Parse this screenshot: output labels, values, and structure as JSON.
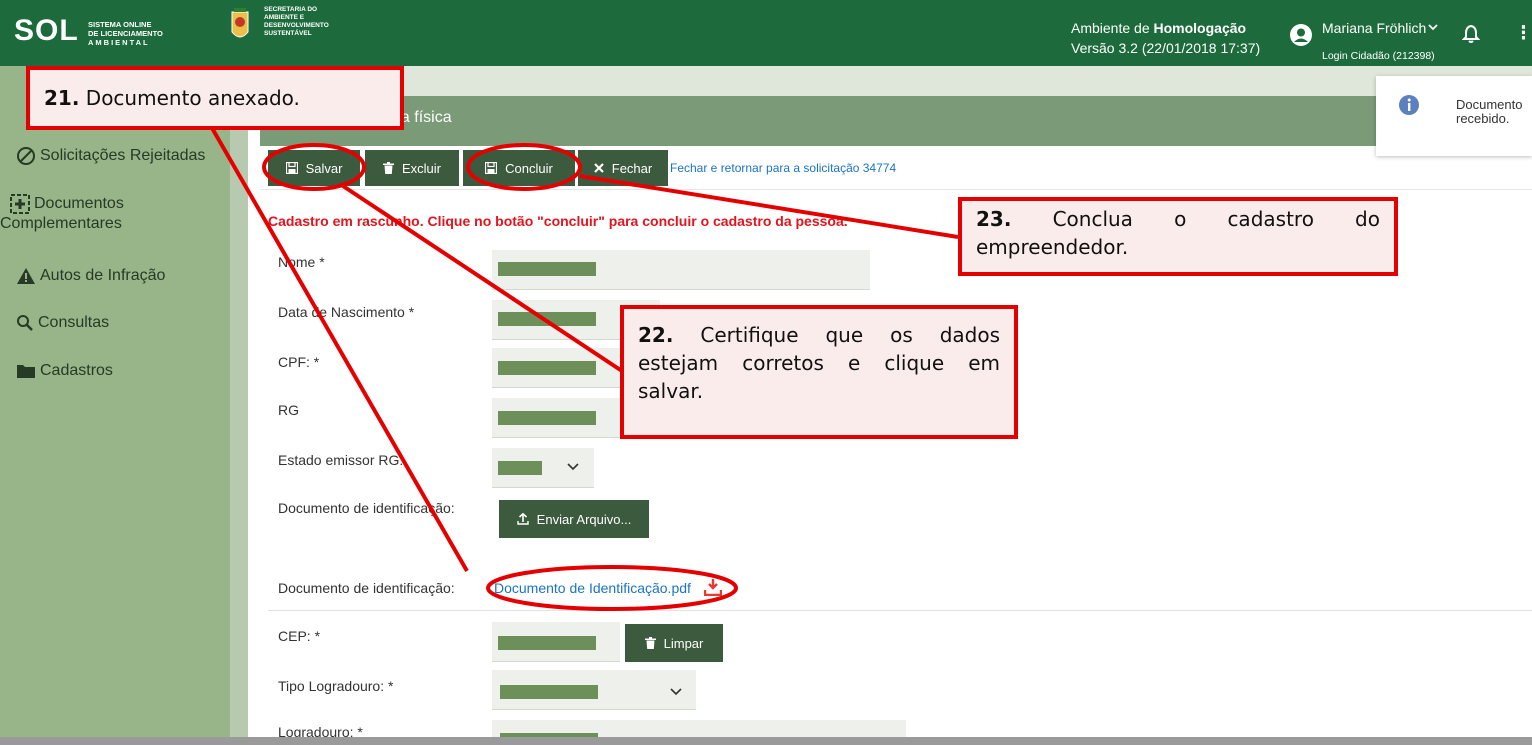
{
  "header": {
    "logo_word": "SOL",
    "logo_sub_line1": "SISTEMA ONLINE",
    "logo_sub_line2": "DE LICENCIAMENTO",
    "logo_sub_line3": "AMBIENTAL",
    "secretaria_line1": "SECRETARIA DO",
    "secretaria_line2": "AMBIENTE E",
    "secretaria_line3": "DESENVOLVIMENTO",
    "secretaria_line4": "SUSTENTÁVEL",
    "env_prefix": "Ambiente de ",
    "env_name": "Homologação",
    "version": "Versão 3.2 (22/01/2018 17:37)",
    "user_name": "Mariana Fröhlich",
    "user_login": "Login Cidadão (212398)"
  },
  "sidebar": {
    "items": [
      {
        "label": "Solicitações Rejeitadas",
        "icon": "circle-slash-icon"
      },
      {
        "label": "Documentos",
        "label2": "Complementares",
        "icon": "plus-box-icon"
      },
      {
        "label": "Autos de Infração",
        "icon": "warning-icon"
      },
      {
        "label": "Consultas",
        "icon": "search-icon"
      },
      {
        "label": "Cadastros",
        "icon": "folder-icon"
      }
    ]
  },
  "page": {
    "title": "oa física",
    "toolbar": {
      "save": "Salvar",
      "delete": "Excluir",
      "conclude": "Concluir",
      "close": "Fechar",
      "back_link": "Fechar e retornar para a solicitação 34774"
    },
    "draft_message": "Cadastro em rascunho. Clique no botão \"concluir\" para concluir o cadastro da pessoa.",
    "fields": {
      "nome": "Nome *",
      "nascimento": "Data de Nascimento *",
      "cpf": "CPF: *",
      "rg": "RG",
      "estado_rg": "Estado emissor RG:",
      "doc_id": "Documento de identificação:",
      "doc_id2": "Documento de identificação:",
      "cep": "CEP: *",
      "tipo_logradouro": "Tipo Logradouro: *",
      "logradouro": "Logradouro: *"
    },
    "upload_label": "Enviar Arquivo...",
    "doc_link": "Documento de Identificação.pdf",
    "clear_label": "Limpar"
  },
  "toast": {
    "line1": "Documento",
    "line2": "recebido."
  },
  "annotations": {
    "c21_num": "21.",
    "c21_text": " Documento anexado.",
    "c22_num": "22.",
    "c22_text": " Certifique que os dados estejam corretos e clique em salvar.",
    "c23_num": "23.",
    "c23_text": " Conclua o cadastro do empreendedor."
  },
  "colors": {
    "header": "#1d6b3c",
    "sidebar": "#98b489",
    "button": "#3c5a3e",
    "annotation": "#e50000"
  }
}
